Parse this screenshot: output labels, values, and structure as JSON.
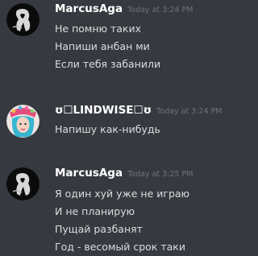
{
  "messages": [
    {
      "author": "MarcusAga",
      "timestamp": "Today at 3:24 PM",
      "lines": [
        "Не помню таких",
        "Напиши анбан ми",
        "Если тебя забанили"
      ]
    },
    {
      "author": "ʊ☐LINDWISE☐ʊ",
      "timestamp": "Today at 3:24 PM",
      "lines": [
        "Напишу как-нибудь"
      ]
    },
    {
      "author": "MarcusAga",
      "timestamp": "Today at 3:25 PM",
      "lines": [
        "Я один хуй уже не играю",
        "И не планирую",
        "Пущай разбанят",
        "Год - весомый срок таки"
      ]
    }
  ]
}
